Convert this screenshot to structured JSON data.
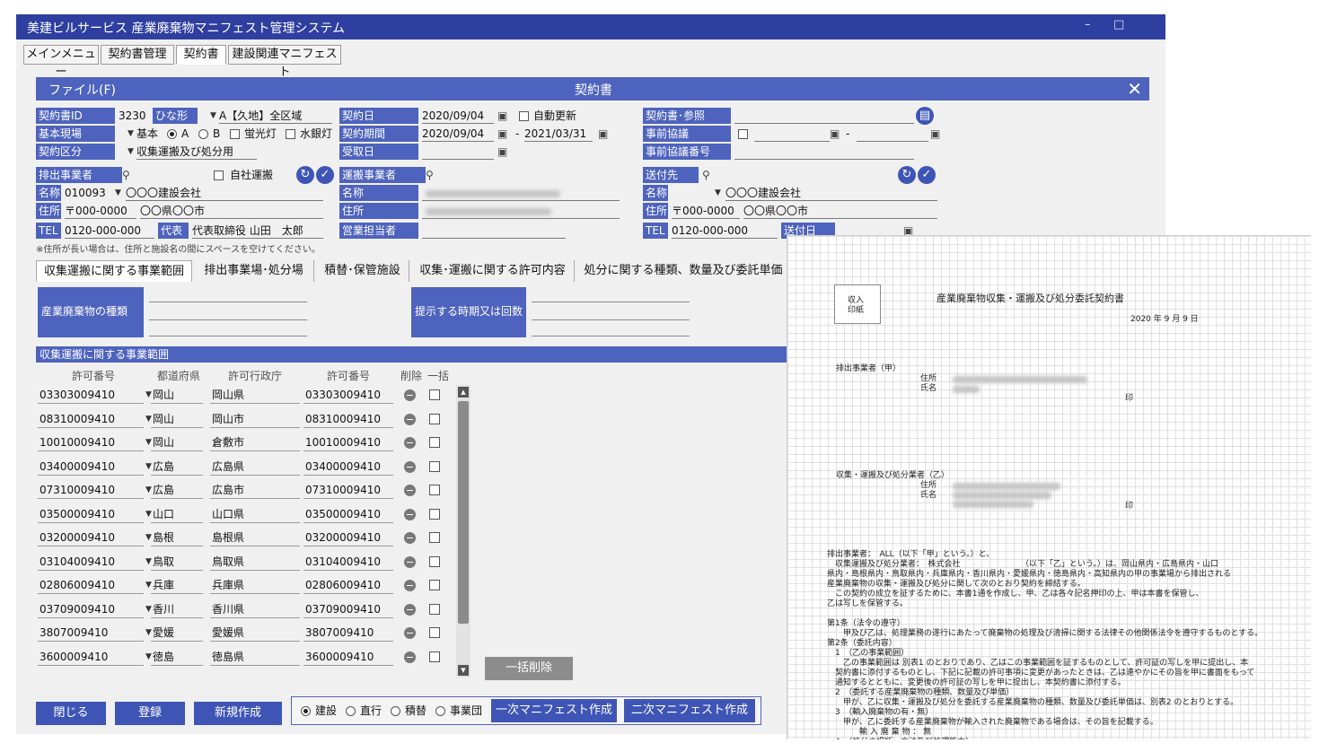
{
  "window": {
    "title": "美建ビルサービス 産業廃棄物マニフェスト管理システム",
    "minimize": "–",
    "maximize": "□"
  },
  "menu_tabs": [
    "メインメニュー",
    "契約書管理",
    "契約書",
    "建設関連マニフェスト"
  ],
  "header": {
    "file_menu": "ファイル(F)",
    "title": "契約書",
    "close": "✕"
  },
  "form": {
    "contract_id_label": "契約書ID",
    "contract_id": "3230",
    "template_label": "ひな形",
    "template_value": "A【久地】全区域",
    "base_site_label": "基本現場",
    "base_site_value": "基本",
    "radio_a": "A",
    "radio_b": "B",
    "fluorescent": "蛍光灯",
    "mercury": "水銀灯",
    "contract_type_label": "契約区分",
    "contract_type_value": "収集運搬及び処分用",
    "contract_date_label": "契約日",
    "contract_date": "2020/09/04",
    "auto_renew": "自動更新",
    "period_label": "契約期間",
    "period_from": "2020/09/04",
    "period_sep": "-",
    "period_to": "2021/03/31",
    "received_label": "受取日",
    "ref_label": "契約書･参照",
    "pre_consult_label": "事前協議",
    "pre_consult_sep": "-",
    "pre_consult_no_label": "事前協議番号"
  },
  "emitter": {
    "label": "排出事業者",
    "self_transport": "自社運搬",
    "name_label": "名称",
    "code": "010093",
    "name": "〇〇〇建設会社",
    "address_label": "住所",
    "zip": "〒000-0000",
    "address": "〇〇県〇〇市",
    "tel_label": "TEL",
    "tel": "0120-000-000",
    "rep_label": "代表",
    "rep": "代表取締役 山田　太郎",
    "note": "※住所が長い場合は、住所と施設名の間にスペースを空けてください。"
  },
  "carrier": {
    "label": "運搬事業者",
    "name_label": "名称",
    "address_label": "住所",
    "sales_label": "営業担当者"
  },
  "sendto": {
    "label": "送付先",
    "name_label": "名称",
    "name": "〇〇〇建設会社",
    "address_label": "住所",
    "zip": "〒000-0000",
    "address": "〇〇県〇〇市",
    "tel_label": "TEL",
    "tel": "0120-000-000",
    "senddate_label": "送付日"
  },
  "subtabs": [
    "収集運搬に関する事業範囲",
    "排出事業場･処分場",
    "積替･保管施設",
    "収集･運搬に関する許可内容",
    "処分に関する種類、数量及び委託単価"
  ],
  "panel": {
    "waste_type_btn": "産業廃棄物の種類",
    "timing_btn": "提示する時期又は回数",
    "range_title": "収集運搬に関する事業範囲"
  },
  "table": {
    "headers": [
      "許可番号",
      "都道府県",
      "許可行政庁",
      "許可番号",
      "削除",
      "一括"
    ],
    "rows": [
      [
        "03303009410",
        "岡山",
        "岡山県",
        "03303009410"
      ],
      [
        "08310009410",
        "岡山",
        "岡山市",
        "08310009410"
      ],
      [
        "10010009410",
        "岡山",
        "倉敷市",
        "10010009410"
      ],
      [
        "03400009410",
        "広島",
        "広島県",
        "03400009410"
      ],
      [
        "07310009410",
        "広島",
        "広島市",
        "07310009410"
      ],
      [
        "03500009410",
        "山口",
        "山口県",
        "03500009410"
      ],
      [
        "03200009410",
        "島根",
        "島根県",
        "03200009410"
      ],
      [
        "03104009410",
        "鳥取",
        "鳥取県",
        "03104009410"
      ],
      [
        "02806009410",
        "兵庫",
        "兵庫県",
        "02806009410"
      ],
      [
        "03709009410",
        "香川",
        "香川県",
        "03709009410"
      ],
      [
        "3807009410",
        "愛媛",
        "愛媛県",
        "3807009410"
      ],
      [
        "3600009410",
        "徳島",
        "徳島県",
        "3600009410"
      ]
    ]
  },
  "buttons": {
    "bulk_delete": "一括削除",
    "close": "閉じる",
    "register": "登録",
    "new": "新規作成",
    "primary_manifest": "一次マニフェスト作成",
    "secondary_manifest": "二次マニフェスト作成"
  },
  "radios": {
    "construction": "建設",
    "direct": "直行",
    "transship": "積替",
    "office": "事業団"
  },
  "document": {
    "stamp_line1": "収入",
    "stamp_line2": "印紙",
    "title": "産業廃棄物収集・運搬及び処分委託契約書",
    "date": "2020 年 9 月 9 日",
    "emitter_head": "排出事業者（甲）",
    "address": "住所",
    "name": "氏名",
    "seal": "印",
    "carrier_head": "収集・運搬及び処分業者（乙）",
    "body": [
      "排出事業者：　ALL（以下「甲」という。）と、",
      "　収集運搬及び処分業者：　株式会社　　　　　　　　（以下「乙」という。）は、岡山県内・広島県内・山口",
      "県内・島根県内・鳥取県内・兵庫県内・香川県内・愛媛県内・徳島県内・高知県内の甲の事業場から排出される",
      "産業廃棄物の収集・運搬及び処分に関して次のとおり契約を締結する。",
      "　この契約の成立を証するために、本書1通を作成し、甲、乙は各々記名押印の上、甲は本書を保管し、",
      "乙は写しを保管する。",
      "",
      "第1条（法令の遵守）",
      "　　甲及び乙は、処理業務の遂行にあたって廃棄物の処理及び清掃に関する法律その他関係法令を遵守するものとする。",
      "第2条（委託内容）",
      "　1　（乙の事業範囲）",
      "　　乙の事業範囲は 別表1 のとおりであり、乙はこの事業範囲を証するものとして、許可証の写しを甲に提出し、本",
      "　契約書に添付するものとし、下記に記載の許可事項に変更があったときは、乙は速やかにその旨を甲に書面をもって",
      "　通知するとともに、変更後の許可証の写しを甲に提出し、本契約書に添付する。",
      "　2　（委託する産業廃棄物の種類、数量及び単価）",
      "　　甲が、乙に収集・運搬及び処分を委託する産業廃棄物の種類、数量及び委託単価は、別表2 のとおりとする。",
      "　3　（輸入廃棄物の有・無）",
      "　　甲が、乙に委託する産業廃棄物が輸入された廃棄物である場合は、その旨を記載する。",
      "　　　　輸 入 廃 棄 物 ： 無",
      "　4　（処分の場所、方法及び処理能力）"
    ]
  }
}
